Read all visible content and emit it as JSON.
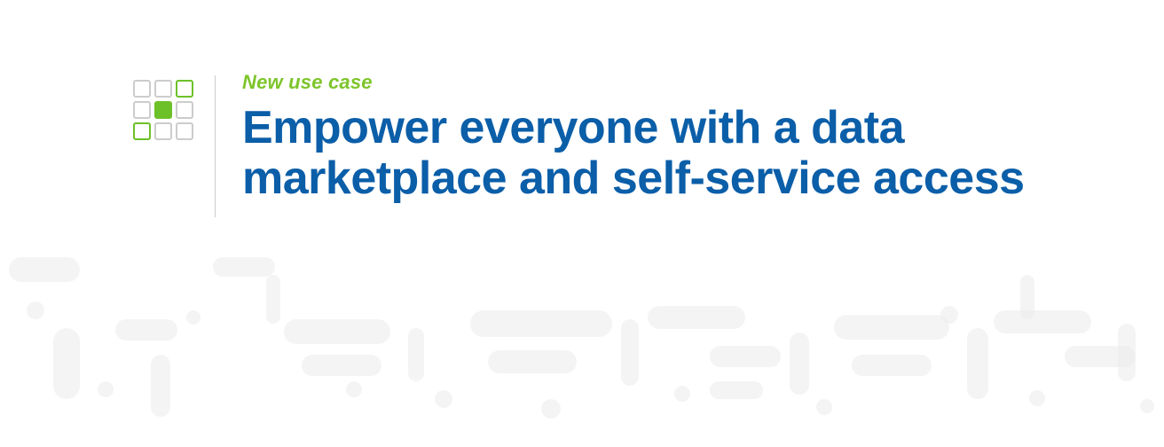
{
  "header": {
    "subtitle": "New use case",
    "title_line1": "Empower everyone with a data",
    "title_line2": "marketplace and self-service access"
  },
  "icon_grid": {
    "rows": [
      [
        "empty",
        "empty",
        "green"
      ],
      [
        "empty",
        "green-filled",
        "empty"
      ],
      [
        "green",
        "empty",
        "empty"
      ]
    ]
  },
  "colors": {
    "green": "#6dc128",
    "blue": "#0b5ea8",
    "divider": "#cccccc",
    "bg_shape": "#ebebeb"
  }
}
